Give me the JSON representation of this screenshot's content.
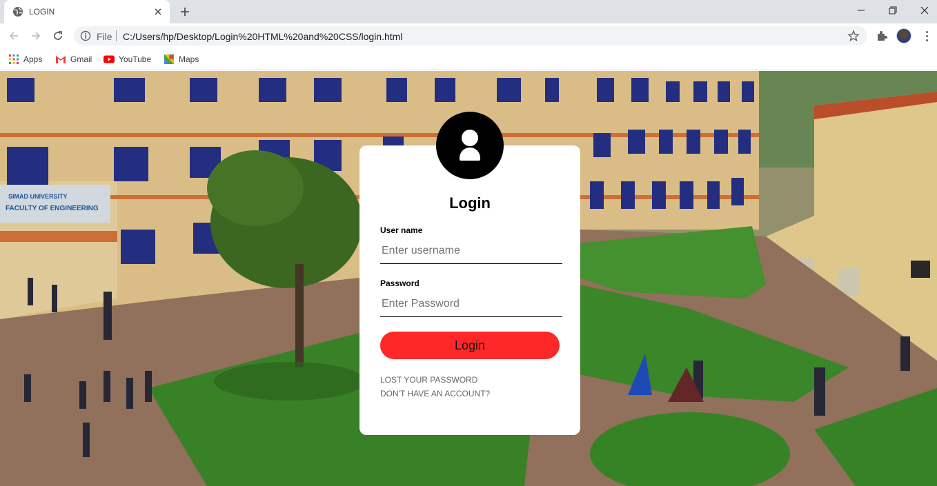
{
  "browser": {
    "tab_title": "LOGIN",
    "address": {
      "scheme_label": "File",
      "url": "C:/Users/hp/Desktop/Login%20HTML%20and%20CSS/login.html"
    },
    "bookmarks": [
      {
        "label": "Apps",
        "icon": "apps-grid-icon"
      },
      {
        "label": "Gmail",
        "icon": "gmail-icon"
      },
      {
        "label": "YouTube",
        "icon": "youtube-icon"
      },
      {
        "label": "Maps",
        "icon": "maps-icon"
      }
    ]
  },
  "login_form": {
    "title": "Login",
    "username": {
      "label": "User name",
      "placeholder": "Enter username"
    },
    "password": {
      "label": "Password",
      "placeholder": "Enter Password"
    },
    "submit_label": "Login",
    "links": {
      "lost_password": "LOST YOUR PASSWORD",
      "no_account": "DON'T HAVE AN ACCOUNT?"
    },
    "accent_color": "#ff2828"
  },
  "background": {
    "signboard_lines": [
      "SIMAD UNIVERSITY",
      "FACULTY OF ENGINEERING"
    ]
  }
}
